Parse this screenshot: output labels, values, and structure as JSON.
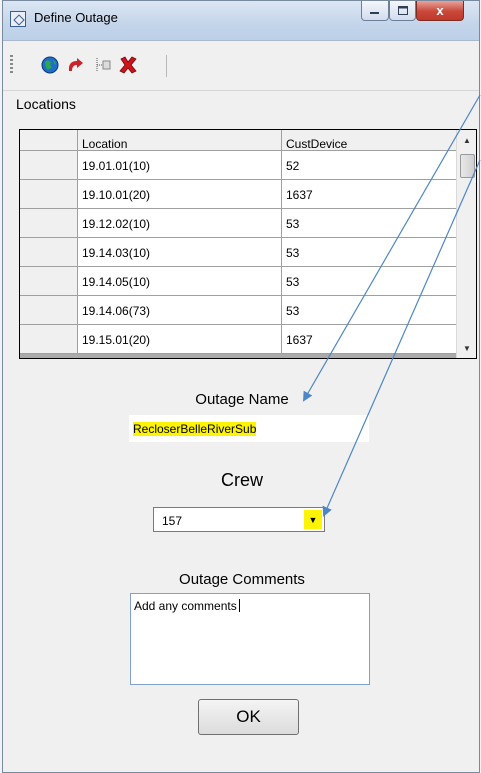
{
  "window": {
    "title": "Define Outage",
    "controls": {
      "minimize_icon": "minimize-icon",
      "maximize_icon": "maximize-icon",
      "close_icon": "close-icon",
      "close_glyph": "x"
    }
  },
  "toolbar": {
    "buttons": [
      {
        "icon": "globe-icon"
      },
      {
        "icon": "redo-arrow-icon"
      },
      {
        "icon": "tree-icon"
      },
      {
        "icon": "delete-x-icon"
      }
    ]
  },
  "locations": {
    "section_label": "Locations",
    "columns": [
      "Location",
      "CustDevice"
    ],
    "rows": [
      [
        "19.01.01(10)",
        "52"
      ],
      [
        "19.10.01(20)",
        "1637"
      ],
      [
        "19.12.02(10)",
        "53"
      ],
      [
        "19.14.03(10)",
        "53"
      ],
      [
        "19.14.05(10)",
        "53"
      ],
      [
        "19.14.06(73)",
        "53"
      ],
      [
        "19.15.01(20)",
        "1637"
      ]
    ]
  },
  "form": {
    "outage_name_label": "Outage Name",
    "outage_name_value": "RecloserBelleRiverSub",
    "crew_label": "Crew",
    "crew_value": "157",
    "comments_label": "Outage Comments",
    "comments_value": "Add any comments",
    "ok_label": "OK"
  },
  "colors": {
    "highlight": "#fcf305",
    "annotation_arrow": "#4f86c6"
  }
}
